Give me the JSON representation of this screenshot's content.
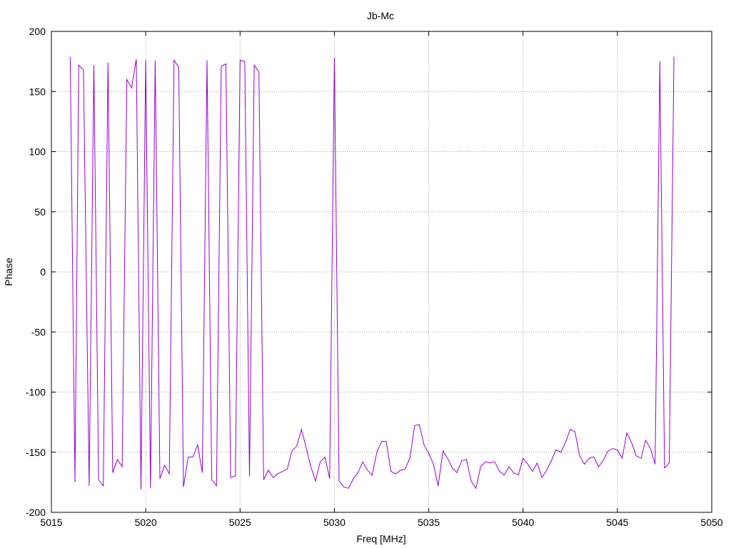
{
  "colors": {
    "series": "#9400d3",
    "grid": "#a0a0a0",
    "axis": "#000000",
    "background": "#ffffff"
  },
  "chart_data": {
    "type": "line",
    "title": "Jb-Mc",
    "xlabel": "Freq [MHz]",
    "ylabel": "Phase",
    "xlim": [
      5015,
      5050
    ],
    "ylim": [
      -200,
      200
    ],
    "xticks": [
      5015,
      5020,
      5025,
      5030,
      5035,
      5040,
      5045,
      5050
    ],
    "yticks": [
      -200,
      -150,
      -100,
      -50,
      0,
      50,
      100,
      150,
      200
    ],
    "grid": true,
    "legend": "none",
    "series": [
      {
        "x": [
          5016.0,
          5016.25,
          5016.45,
          5016.7,
          5017.0,
          5017.25,
          5017.5,
          5017.75,
          5018.0,
          5018.25,
          5018.5,
          5018.75,
          5019.0,
          5019.25,
          5019.5,
          5019.75,
          5020.0,
          5020.25,
          5020.5,
          5020.75,
          5021.0,
          5021.25,
          5021.5,
          5021.75,
          5022.0,
          5022.25,
          5022.5,
          5022.75,
          5023.0,
          5023.25,
          5023.5,
          5023.75,
          5024.0,
          5024.25,
          5024.5,
          5024.75,
          5025.0,
          5025.25,
          5025.5,
          5025.75,
          5026.0,
          5026.25,
          5026.5,
          5026.75,
          5027.0,
          5027.25,
          5027.5,
          5027.75,
          5028.0,
          5028.25,
          5028.5,
          5028.75,
          5029.0,
          5029.25,
          5029.5,
          5029.75,
          5030.0,
          5030.25,
          5030.5,
          5030.75,
          5031.0,
          5031.25,
          5031.5,
          5031.75,
          5032.0,
          5032.25,
          5032.5,
          5032.75,
          5033.0,
          5033.25,
          5033.5,
          5033.75,
          5034.0,
          5034.25,
          5034.5,
          5034.75,
          5035.0,
          5035.25,
          5035.5,
          5035.75,
          5036.0,
          5036.25,
          5036.5,
          5036.75,
          5037.0,
          5037.25,
          5037.5,
          5037.75,
          5038.0,
          5038.25,
          5038.5,
          5038.75,
          5039.0,
          5039.25,
          5039.5,
          5039.75,
          5040.0,
          5040.25,
          5040.5,
          5040.75,
          5041.0,
          5041.25,
          5041.5,
          5041.75,
          5042.0,
          5042.25,
          5042.5,
          5042.75,
          5043.0,
          5043.25,
          5043.5,
          5043.75,
          5044.0,
          5044.25,
          5044.5,
          5044.75,
          5045.0,
          5045.25,
          5045.5,
          5045.75,
          5046.0,
          5046.25,
          5046.5,
          5046.75,
          5047.0,
          5047.25,
          5047.5,
          5047.75,
          5048.0
        ],
        "y": [
          179,
          -175,
          172,
          168,
          -178,
          172,
          -173,
          -178,
          174,
          -167,
          -156,
          -162,
          160,
          153,
          177,
          -181,
          176,
          -180,
          176,
          -172,
          -161,
          -168,
          176,
          170,
          -179,
          -154,
          -154,
          -144,
          -167,
          176,
          -173,
          -178,
          171,
          173,
          -171,
          -170,
          176,
          175,
          -170,
          172,
          166,
          -173,
          -165,
          -171,
          -168,
          -166,
          -164,
          -149,
          -145,
          -131,
          -146,
          -162,
          -174,
          -158,
          -154,
          -172,
          178,
          -174,
          -179,
          -180,
          -172,
          -167,
          -158,
          -165,
          -169,
          -150,
          -141,
          -141,
          -166,
          -168,
          -165,
          -164,
          -155,
          -128,
          -127,
          -144,
          -151,
          -160,
          -178,
          -149,
          -155,
          -163,
          -167,
          -157,
          -156,
          -174,
          -180,
          -162,
          -158,
          -159,
          -158,
          -166,
          -169,
          -162,
          -167,
          -169,
          -155,
          -160,
          -166,
          -159,
          -171,
          -165,
          -157,
          -148,
          -150,
          -142,
          -131,
          -133,
          -153,
          -160,
          -155,
          -154,
          -162,
          -157,
          -149,
          -147,
          -148,
          -155,
          -134,
          -142,
          -153,
          -155,
          -140,
          -147,
          -160,
          175,
          -163,
          -159,
          179
        ]
      }
    ]
  }
}
